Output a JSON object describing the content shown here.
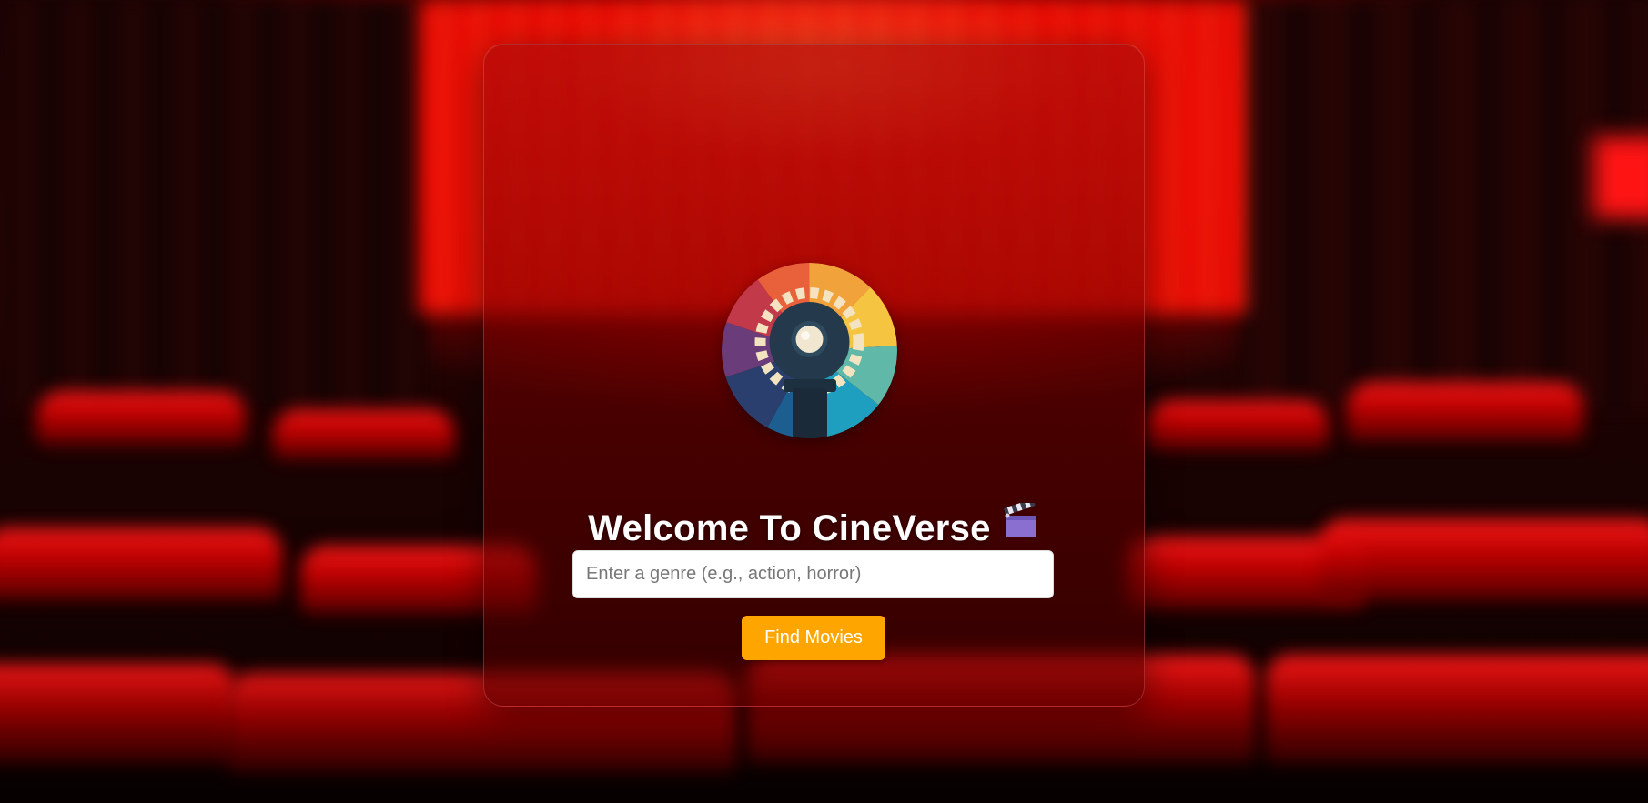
{
  "hero": {
    "title_prefix": "Welcome To ",
    "title_brand": "CineVerse",
    "clapper_icon": "clapperboard-icon",
    "logo_icon": "film-projector-logo-icon"
  },
  "search": {
    "placeholder": "Enter a genre (e.g., action, horror)",
    "value": ""
  },
  "actions": {
    "find_label": "Find Movies"
  },
  "colors": {
    "accent_button": "#ffa500",
    "background_primary": "#b00000",
    "input_background": "#ffffff",
    "title_text": "#ffffff"
  }
}
